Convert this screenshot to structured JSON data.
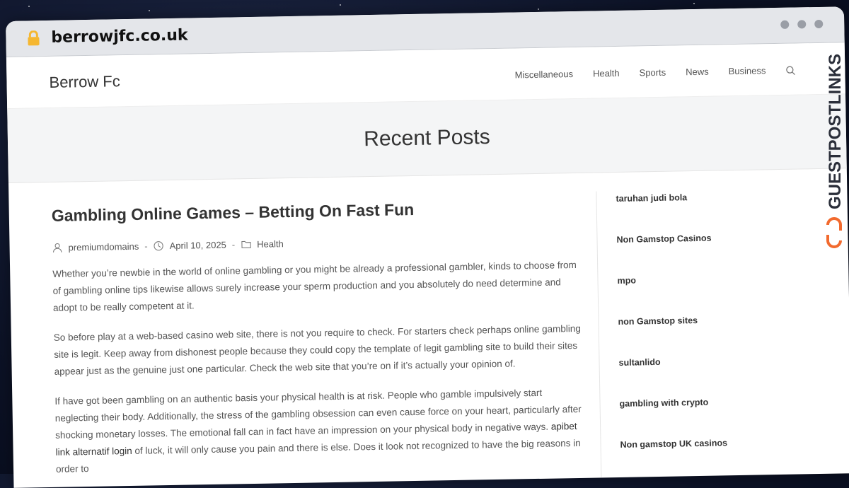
{
  "browser": {
    "url": "berrowjfc.co.uk"
  },
  "site": {
    "brand": "Berrow Fc",
    "nav": [
      "Miscellaneous",
      "Health",
      "Sports",
      "News",
      "Business"
    ]
  },
  "hero": {
    "title": "Recent Posts"
  },
  "article": {
    "title": "Gambling Online Games – Betting On Fast Fun",
    "author": "premiumdomains",
    "date": "April 10, 2025",
    "category": "Health",
    "p1": "Whether you’re newbie in the world of online gambling or you might be already a professional gambler, kinds to choose from of gambling online tips likewise allows surely increase your sperm production and you absolutely do need determine and adopt to be really competent at it.",
    "p2": "So before play at a web-based casino web site, there is not you require to check. For starters check perhaps online gambling site is legit. Keep away from dishonest people because they could copy the template of legit gambling site to build their sites appear just as the genuine just one particular. Check the web site that you’re on if it’s actually your opinion of.",
    "p3_a": "If have got been gambling on an authentic basis your physical health is at risk. People who gamble impulsively start neglecting their body. Additionally, the stress of the gambling obsession can even cause force on your heart, particularly after shocking monetary losses. The emotional fall can in fact have an impression on your physical body in negative ways. ",
    "p3_link": "apibet link alternatif login",
    "p3_b": " of luck, it will only cause you pain and there is else. Does it look not recognized to have the big reasons in order to"
  },
  "sidebar": {
    "links": [
      "taruhan judi bola",
      "Non Gamstop Casinos",
      "mpo",
      "non Gamstop sites",
      "sultanlido",
      "gambling with crypto",
      "Non gamstop UK casinos"
    ]
  },
  "badge": {
    "text": "GUESTPOSTLINKS"
  },
  "colors": {
    "badge_orange": "#f26a2e",
    "badge_dark": "#2b2f3a"
  }
}
